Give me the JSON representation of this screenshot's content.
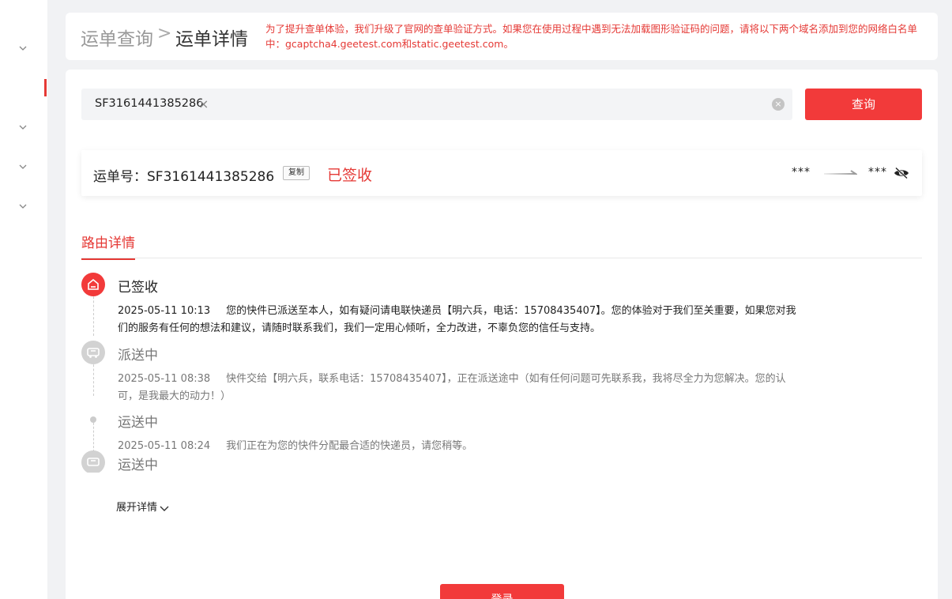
{
  "breadcrumb": {
    "root": "运单查询",
    "separator": ">",
    "current": "运单详情"
  },
  "notice": "为了提升查单体验，我们升级了官网的查单验证方式。如果您在使用过程中遇到无法加载图形验证码的问题，请将以下两个域名添加到您的网络白名单中：gcaptcha4.geetest.com和static.geetest.com。",
  "search": {
    "tag_value": "SF3161441385286",
    "tag_close": "×",
    "clear": "×",
    "button_label": "查询"
  },
  "waybill": {
    "label": "运单号：SF3161441385286",
    "copy_label": "复制",
    "status": "已签收",
    "from": "***",
    "to": "***"
  },
  "tabs": {
    "route_detail": "路由详情"
  },
  "timeline": [
    {
      "title": "已签收",
      "time": "2025-05-11 10:13",
      "desc": "您的快件已派送至本人，如有疑问请电联快递员【明六兵，电话：15708435407】。您的体验对于我们至关重要，如果您对我们的服务有任何的想法和建议，请随时联系我们，我们一定用心倾听，全力改进，不辜负您的信任与支持。"
    },
    {
      "title": "派送中",
      "time": "2025-05-11 08:38",
      "desc": "快件交给【明六兵，联系电话：15708435407】，正在派送途中（如有任何问题可先联系我，我将尽全力为您解决。您的认可，是我最大的动力！）"
    },
    {
      "title": "运送中",
      "time": "2025-05-11 08:24",
      "desc": "我们正在为您的快件分配最合适的快递员，请您稍等。"
    },
    {
      "title": "运送中",
      "time": "",
      "desc": ""
    }
  ],
  "expand_label": "展开详情",
  "login_label": "登录",
  "colors": {
    "accent": "#f23a3a",
    "accent_text": "#e53935",
    "background": "#f1f2f4"
  }
}
